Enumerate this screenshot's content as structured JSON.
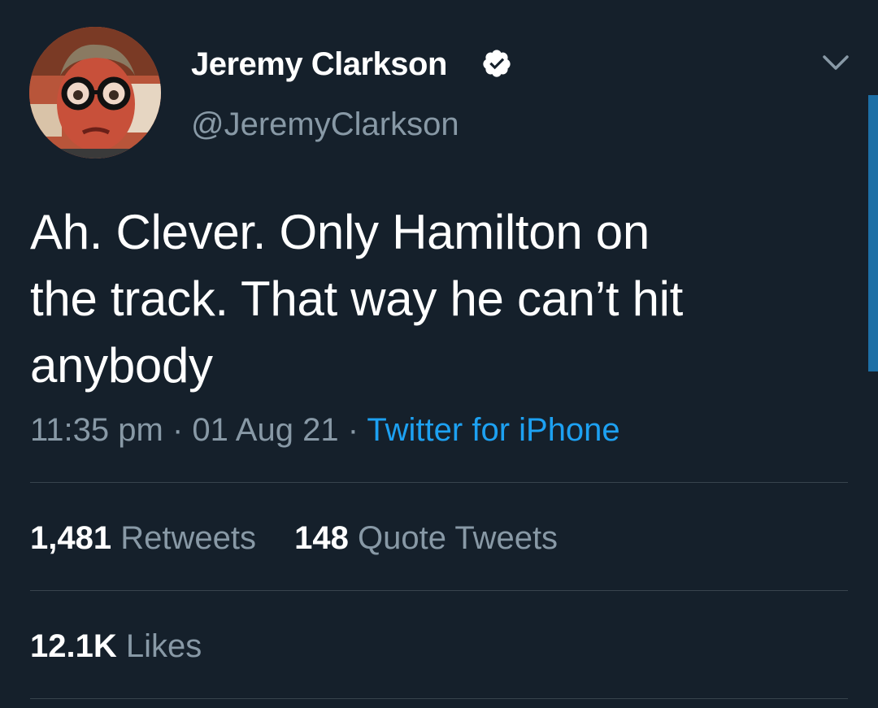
{
  "tweet": {
    "author": {
      "display_name": "Jeremy Clarkson",
      "handle": "@JeremyClarkson",
      "verified": true,
      "avatar_icon": "profile-photo"
    },
    "text": "Ah. Clever. Only Hamilton on\nthe track. That way he can’t hit\nanybody",
    "time": "11:35 pm",
    "separator": "·",
    "date": "01 Aug 21",
    "source": "Twitter for iPhone",
    "stats": {
      "retweets_count": "1,481",
      "retweets_label": "Retweets",
      "quotes_count": "148",
      "quotes_label": "Quote Tweets",
      "likes_count": "12.1K",
      "likes_label": "Likes"
    }
  },
  "colors": {
    "background": "#15202b",
    "primary_text": "#ffffff",
    "secondary_text": "#8899a6",
    "link": "#1da1f2",
    "divider": "#38444d"
  }
}
